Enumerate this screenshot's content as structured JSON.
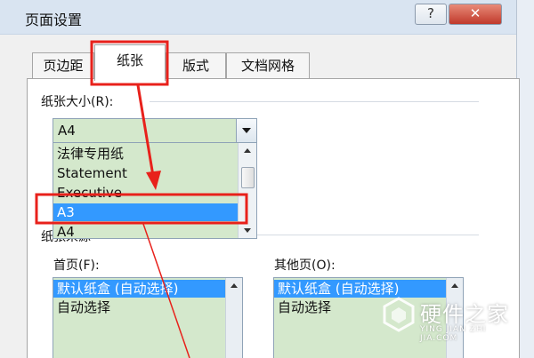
{
  "window": {
    "title": "页面设置",
    "help_label": "?",
    "close_label": "✕"
  },
  "tabs": [
    {
      "label": "页边距",
      "active": false
    },
    {
      "label": "纸张",
      "active": true
    },
    {
      "label": "版式",
      "active": false
    },
    {
      "label": "文档网格",
      "active": false
    }
  ],
  "paper_size": {
    "label": "纸张大小(R):",
    "selected_value": "A4",
    "options": [
      "法律专用纸",
      "Statement",
      "Executive",
      "A3",
      "A4"
    ],
    "highlighted_option": "A3"
  },
  "paper_source": {
    "label": "纸张来源",
    "first_page": {
      "label": "首页(F):",
      "items": [
        "默认纸盒 (自动选择)",
        "自动选择"
      ],
      "selected": "默认纸盒 (自动选择)"
    },
    "other_pages": {
      "label": "其他页(O):",
      "items": [
        "默认纸盒 (自动选择)",
        "自动选择"
      ],
      "selected": "默认纸盒 (自动选择)"
    }
  },
  "watermark": {
    "text": "硬件之家",
    "subtext": "YING JIAN ZHI JIA.COM"
  },
  "colors": {
    "annotation": "#e8211b",
    "selection": "#3399ff",
    "list_bg": "#d4e8cc",
    "titlebar": "#d9e4f1"
  }
}
